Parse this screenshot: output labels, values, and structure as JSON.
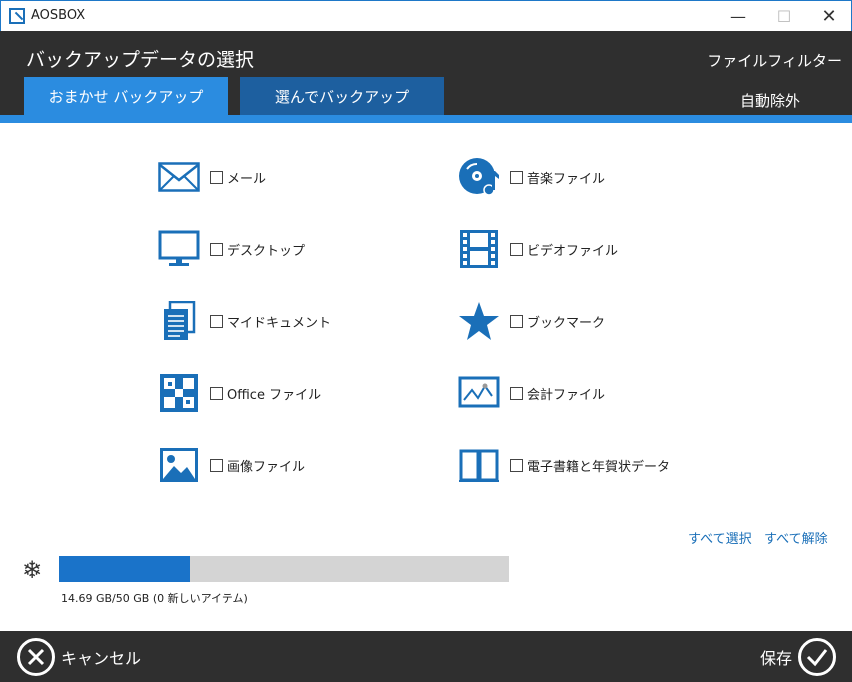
{
  "window": {
    "title": "AOSBOX",
    "minimize": "—",
    "maximize": "☐",
    "close": "✕"
  },
  "header": {
    "title": "バックアップデータの選択",
    "file_filter": "ファイルフィルター",
    "auto_exclude": "自動除外"
  },
  "tabs": [
    {
      "label": "おまかせ バックアップ",
      "active": true
    },
    {
      "label": "選んでバックアップ",
      "active": false
    }
  ],
  "categories": [
    {
      "label": "メール",
      "icon": "mail-icon",
      "checked": false
    },
    {
      "label": "音楽ファイル",
      "icon": "music-icon",
      "checked": false
    },
    {
      "label": "デスクトップ",
      "icon": "desktop-icon",
      "checked": false
    },
    {
      "label": "ビデオファイル",
      "icon": "video-icon",
      "checked": false
    },
    {
      "label": "マイドキュメント",
      "icon": "documents-icon",
      "checked": false
    },
    {
      "label": "ブックマーク",
      "icon": "star-icon",
      "checked": false
    },
    {
      "label": "Office ファイル",
      "icon": "office-icon",
      "checked": false
    },
    {
      "label": "会計ファイル",
      "icon": "accounting-icon",
      "checked": false
    },
    {
      "label": "画像ファイル",
      "icon": "image-icon",
      "checked": false
    },
    {
      "label": "電子書籍と年賀状データ",
      "icon": "book-icon",
      "checked": false
    }
  ],
  "links": {
    "select_all": "すべて選択",
    "deselect_all": "すべて解除"
  },
  "storage": {
    "text": "14.69 GB/50 GB (0 新しいアイテム)",
    "used_fraction": 0.29,
    "icon": "snowflake-icon"
  },
  "footer": {
    "cancel": "キャンセル",
    "save": "保存"
  },
  "colors": {
    "accent": "#2b8ce0",
    "tab_inactive": "#1d5f9f",
    "header_bg": "#2f2f2f",
    "bar_fill": "#1a73c9",
    "icon_blue": "#1a6fb8"
  }
}
